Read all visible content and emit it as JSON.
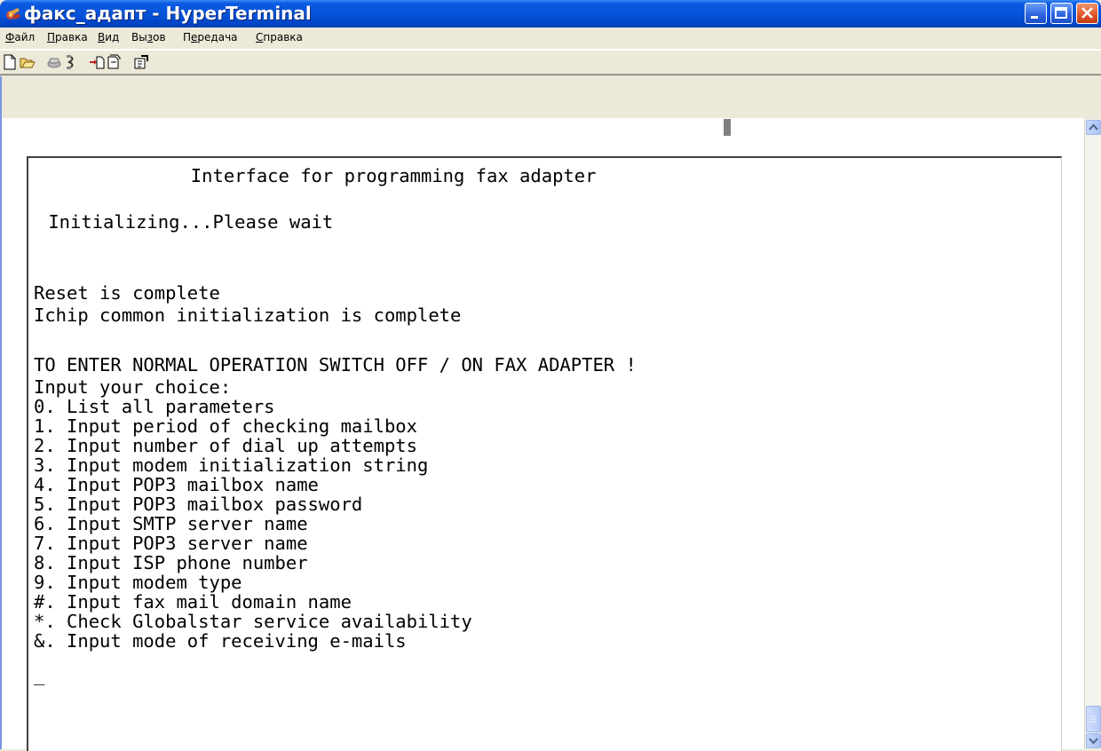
{
  "window": {
    "title": "факс_адапт - HyperTerminal",
    "controls": [
      "minimize",
      "maximize",
      "close"
    ]
  },
  "menu": [
    {
      "label": "Файл",
      "accel": "Ф",
      "rest": "айл"
    },
    {
      "label": "Правка",
      "accel": "П",
      "rest": "равка"
    },
    {
      "label": "Вид",
      "accel": "В",
      "rest": "ид"
    },
    {
      "label": "Вызов",
      "accel_prefix": "Вы",
      "accel": "з",
      "rest": "ов"
    },
    {
      "label": "Передача",
      "accel_prefix": "П",
      "accel": "е",
      "rest": "редача"
    },
    {
      "label": "Справка",
      "accel": "С",
      "rest": "правка"
    }
  ],
  "toolbar": {
    "icons": [
      "new-icon",
      "open-icon",
      "connect-icon",
      "disconnect-icon",
      "send-icon",
      "receive-icon",
      "properties-icon"
    ]
  },
  "terminal": {
    "lines": [
      "              Interface for programming fax adapter",
      " Initializing...Please wait",
      "Reset is complete",
      "Ichip common initialization is complete",
      "TO ENTER NORMAL OPERATION SWITCH OFF / ON FAX ADAPTER !",
      "Input your choice:",
      "0. List all parameters",
      "1. Input period of checking mailbox",
      "2. Input number of dial up attempts",
      "3. Input modem initialization string",
      "4. Input POP3 mailbox name",
      "5. Input POP3 mailbox password",
      "6. Input SMTP server name",
      "7. Input POP3 server name",
      "8. Input ISP phone number",
      "9. Input modem type",
      "#. Input fax mail domain name",
      "*. Check Globalstar service availability",
      "&. Input mode of receiving e-mails",
      "_"
    ]
  },
  "colors": {
    "titlebar": "#0754d9",
    "chrome": "#ece9d8",
    "terminal_bg": "#ffffff",
    "text": "#000000"
  }
}
